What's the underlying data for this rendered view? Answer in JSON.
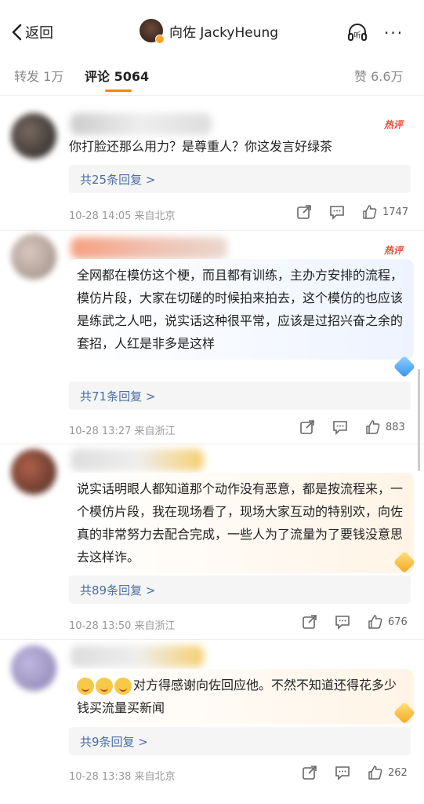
{
  "nav": {
    "back_label": "返回",
    "user_name": "向佐 JackyHeung",
    "listen_label": "听",
    "more_label": "···"
  },
  "tabs": {
    "repost": "转发 1万",
    "comments": "评论 5064",
    "likes": "赞 6.6万"
  },
  "comments": [
    {
      "hot_tag": "热评",
      "text": "你打脸还那么用力？是尊重人？你这发言好绿茶",
      "replies": "共25条回复 >",
      "meta": "10-28 14:05  来自北京",
      "likes": "1747"
    },
    {
      "hot_tag": "热评",
      "text": "全网都在模仿这个梗，而且都有训练，主办方安排的流程，模仿片段，大家在切磋的时候拍来拍去，这个模仿的也应该是练武之人吧，说实话这种很平常，应该是过招兴奋之余的套招，人红是非多是这样",
      "replies": "共71条回复 >",
      "meta": "10-28 13:27  来自浙江",
      "likes": "883"
    },
    {
      "text": "说实话明眼人都知道那个动作没有恶意，都是按流程来，一个模仿片段，我在现场看了，现场大家互动的特别欢，向佐真的非常努力去配合完成，一些人为了流量为了要钱没意思去这样诈。",
      "replies": "共89条回复 >",
      "meta": "10-28 13:50  来自浙江",
      "likes": "676"
    },
    {
      "text": "对方得感谢向佐回应他。不然不知道还得花多少钱买流量买新闻",
      "replies": "共9条回复 >",
      "meta": "10-28 13:38  来自北京",
      "likes": "262"
    }
  ]
}
